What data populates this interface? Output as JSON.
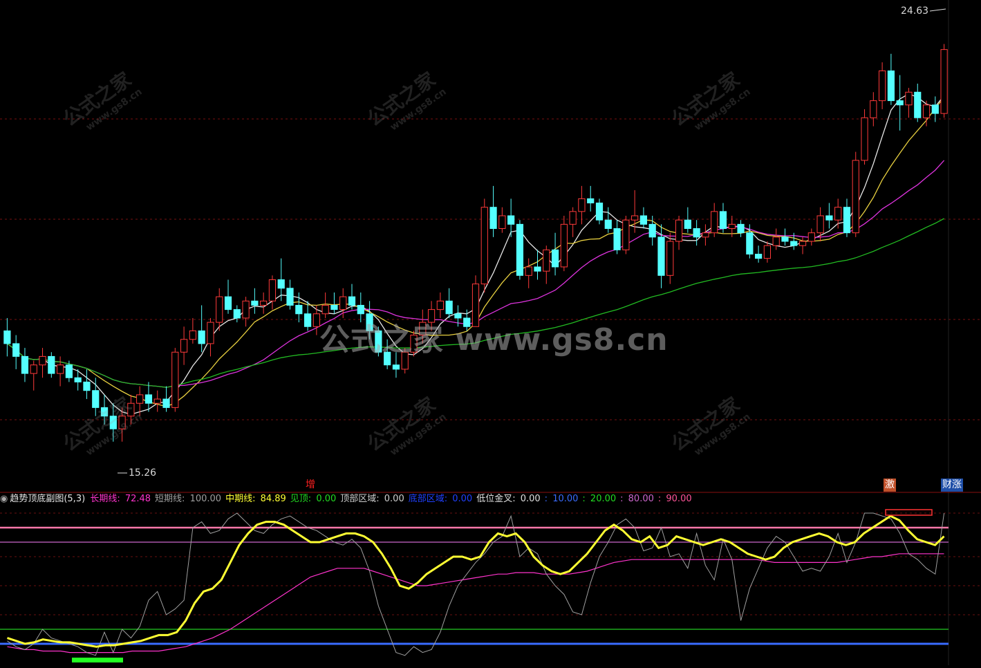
{
  "main_chart": {
    "price_high_label": "24.63",
    "price_low_label": "15.26",
    "watermark_center": "公式之家 www.gs8.cn",
    "watermark_small_cn": "公式之家",
    "watermark_small_url": "www.gs8.cn"
  },
  "signals": [
    {
      "text": "增",
      "color": "#ff2020",
      "bg": "#000"
    },
    {
      "text": "激",
      "color": "#fff",
      "bg": "#c0502a"
    },
    {
      "text": "财涨",
      "color": "#fff",
      "bg": "#1f4fa8"
    }
  ],
  "indicator_legend": {
    "title": "趋势顶底副图(5,3)",
    "items": [
      {
        "label": "长期线: ",
        "value": "72.48",
        "color": "#ff33cc"
      },
      {
        "label": "短期线: ",
        "value": "100.00",
        "color": "#a0a0a0"
      },
      {
        "label": "中期线: ",
        "value": "84.89",
        "color": "#ffff33"
      },
      {
        "label": "见顶: ",
        "value": "0.00",
        "color": "#22dd22"
      },
      {
        "label": "顶部区域: ",
        "value": "0.00",
        "color": "#cfcfcf"
      },
      {
        "label": "底部区域: ",
        "value": "0.00",
        "color": "#2040ff"
      },
      {
        "label": "低位金叉: ",
        "value": "0.00",
        "color": "#e0e0e0"
      },
      {
        "label": ": ",
        "value": "10.00",
        "color": "#3a6cff"
      },
      {
        "label": ": ",
        "value": "20.00",
        "color": "#22dd22"
      },
      {
        "label": ": ",
        "value": "80.00",
        "color": "#cc66cc"
      },
      {
        "label": ": ",
        "value": "90.00",
        "color": "#ff5599"
      }
    ]
  },
  "chart_data": [
    {
      "type": "candlestick",
      "title": "",
      "ylim": [
        14.5,
        25.5
      ],
      "high": 24.63,
      "low": 15.26,
      "candles": [
        [
          17.9,
          18.2,
          17.3,
          17.6
        ],
        [
          17.6,
          17.8,
          17.0,
          17.3
        ],
        [
          17.3,
          17.5,
          16.7,
          16.9
        ],
        [
          16.9,
          17.2,
          16.5,
          17.1
        ],
        [
          17.1,
          17.5,
          16.8,
          17.3
        ],
        [
          17.3,
          17.4,
          16.8,
          16.9
        ],
        [
          16.9,
          17.3,
          16.6,
          17.1
        ],
        [
          17.1,
          17.2,
          16.7,
          16.8
        ],
        [
          16.8,
          17.0,
          16.5,
          16.7
        ],
        [
          16.7,
          17.0,
          16.3,
          16.5
        ],
        [
          16.5,
          16.8,
          15.9,
          16.1
        ],
        [
          16.1,
          16.4,
          15.7,
          15.9
        ],
        [
          15.9,
          16.2,
          15.3,
          15.6
        ],
        [
          15.6,
          16.1,
          15.3,
          15.9
        ],
        [
          15.9,
          16.4,
          15.7,
          16.2
        ],
        [
          16.2,
          16.6,
          15.9,
          16.4
        ],
        [
          16.4,
          16.7,
          16.0,
          16.2
        ],
        [
          16.2,
          16.5,
          16.0,
          16.3
        ],
        [
          16.3,
          16.6,
          16.0,
          16.1
        ],
        [
          16.1,
          17.5,
          16.0,
          17.4
        ],
        [
          17.4,
          18.0,
          17.1,
          17.7
        ],
        [
          17.7,
          18.2,
          17.6,
          17.9
        ],
        [
          17.9,
          18.5,
          17.4,
          17.6
        ],
        [
          17.6,
          18.2,
          17.3,
          18.1
        ],
        [
          18.1,
          18.9,
          17.9,
          18.7
        ],
        [
          18.7,
          19.1,
          18.3,
          18.4
        ],
        [
          18.4,
          18.5,
          18.1,
          18.2
        ],
        [
          18.2,
          18.7,
          18.0,
          18.6
        ],
        [
          18.6,
          18.9,
          18.3,
          18.5
        ],
        [
          18.5,
          18.8,
          18.3,
          18.6
        ],
        [
          18.6,
          19.2,
          18.4,
          19.1
        ],
        [
          19.1,
          19.6,
          18.6,
          18.9
        ],
        [
          18.9,
          19.1,
          18.4,
          18.5
        ],
        [
          18.5,
          18.8,
          18.1,
          18.3
        ],
        [
          18.3,
          18.6,
          17.9,
          18.0
        ],
        [
          18.0,
          18.5,
          17.8,
          18.3
        ],
        [
          18.3,
          18.8,
          18.2,
          18.5
        ],
        [
          18.5,
          18.8,
          18.3,
          18.4
        ],
        [
          18.4,
          18.9,
          18.2,
          18.7
        ],
        [
          18.7,
          19.0,
          18.4,
          18.5
        ],
        [
          18.5,
          18.8,
          18.1,
          18.3
        ],
        [
          18.3,
          18.6,
          17.7,
          17.9
        ],
        [
          17.9,
          18.0,
          17.3,
          17.4
        ],
        [
          17.4,
          17.7,
          17.0,
          17.1
        ],
        [
          17.1,
          17.4,
          16.8,
          17.0
        ],
        [
          17.0,
          17.5,
          16.9,
          17.4
        ],
        [
          17.4,
          17.9,
          17.3,
          17.8
        ],
        [
          17.8,
          18.4,
          17.6,
          18.1
        ],
        [
          18.1,
          18.6,
          17.9,
          18.4
        ],
        [
          18.4,
          18.8,
          18.2,
          18.6
        ],
        [
          18.6,
          18.9,
          18.2,
          18.3
        ],
        [
          18.3,
          18.5,
          18.0,
          18.2
        ],
        [
          18.2,
          18.4,
          17.9,
          18.0
        ],
        [
          18.0,
          19.2,
          18.0,
          19.0
        ],
        [
          19.0,
          21.0,
          18.8,
          20.8
        ],
        [
          20.8,
          21.3,
          20.1,
          20.3
        ],
        [
          20.3,
          20.8,
          20.2,
          20.6
        ],
        [
          20.6,
          21.0,
          20.1,
          20.4
        ],
        [
          20.4,
          20.5,
          19.1,
          19.2
        ],
        [
          19.2,
          19.6,
          18.9,
          19.4
        ],
        [
          19.4,
          19.8,
          19.1,
          19.3
        ],
        [
          19.3,
          19.9,
          19.0,
          19.8
        ],
        [
          19.8,
          20.2,
          19.2,
          19.4
        ],
        [
          19.4,
          20.6,
          19.3,
          20.4
        ],
        [
          20.4,
          20.8,
          20.1,
          20.7
        ],
        [
          20.7,
          21.3,
          20.4,
          21.0
        ],
        [
          21.0,
          21.3,
          20.7,
          20.9
        ],
        [
          20.9,
          21.0,
          20.4,
          20.5
        ],
        [
          20.5,
          20.8,
          20.2,
          20.3
        ],
        [
          20.3,
          20.5,
          19.7,
          19.8
        ],
        [
          19.8,
          20.6,
          19.7,
          20.5
        ],
        [
          20.5,
          21.2,
          20.2,
          20.6
        ],
        [
          20.6,
          20.8,
          20.3,
          20.4
        ],
        [
          20.4,
          20.6,
          19.9,
          20.1
        ],
        [
          20.1,
          20.4,
          18.9,
          19.2
        ],
        [
          19.2,
          20.2,
          19.0,
          20.0
        ],
        [
          20.0,
          20.6,
          19.8,
          20.5
        ],
        [
          20.5,
          20.8,
          20.2,
          20.3
        ],
        [
          20.3,
          20.5,
          19.9,
          20.1
        ],
        [
          20.1,
          20.4,
          19.9,
          20.2
        ],
        [
          20.2,
          20.9,
          20.1,
          20.7
        ],
        [
          20.7,
          20.9,
          20.2,
          20.3
        ],
        [
          20.3,
          20.6,
          20.1,
          20.4
        ],
        [
          20.4,
          20.5,
          20.1,
          20.2
        ],
        [
          20.2,
          20.4,
          19.6,
          19.7
        ],
        [
          19.7,
          19.9,
          19.5,
          19.6
        ],
        [
          19.6,
          20.0,
          19.5,
          19.9
        ],
        [
          19.9,
          20.3,
          19.8,
          20.1
        ],
        [
          20.1,
          20.3,
          19.9,
          20.0
        ],
        [
          20.0,
          20.2,
          19.8,
          19.9
        ],
        [
          19.9,
          20.1,
          19.7,
          20.0
        ],
        [
          20.0,
          20.3,
          19.9,
          20.2
        ],
        [
          20.2,
          20.8,
          20.0,
          20.6
        ],
        [
          20.6,
          20.9,
          20.3,
          20.5
        ],
        [
          20.5,
          21.0,
          20.3,
          20.8
        ],
        [
          20.8,
          21.0,
          20.1,
          20.2
        ],
        [
          20.2,
          22.1,
          20.1,
          21.9
        ],
        [
          21.9,
          23.1,
          21.8,
          22.9
        ],
        [
          22.9,
          23.5,
          22.7,
          23.3
        ],
        [
          23.3,
          24.2,
          23.1,
          24.0
        ],
        [
          24.0,
          24.4,
          23.2,
          23.3
        ],
        [
          23.3,
          23.9,
          22.6,
          23.2
        ],
        [
          23.2,
          23.6,
          22.9,
          23.5
        ],
        [
          23.5,
          23.7,
          22.8,
          22.9
        ],
        [
          22.9,
          23.3,
          22.7,
          23.2
        ],
        [
          23.2,
          23.4,
          22.8,
          23.0
        ],
        [
          23.0,
          24.63,
          22.9,
          24.5
        ]
      ]
    },
    {
      "type": "line",
      "title": "趋势顶底副图(5,3)",
      "ylim": [
        0,
        100
      ],
      "reference_lines": [
        10,
        20,
        80,
        90
      ],
      "series": [
        {
          "name": "长期线",
          "color": "#ff33cc",
          "values": [
            8,
            7,
            6,
            6,
            5,
            5,
            5,
            4,
            4,
            4,
            4,
            4,
            4,
            4,
            5,
            5,
            5,
            5,
            6,
            7,
            8,
            10,
            12,
            14,
            17,
            20,
            24,
            28,
            32,
            36,
            40,
            44,
            48,
            52,
            56,
            58,
            60,
            62,
            62,
            62,
            62,
            60,
            58,
            56,
            54,
            52,
            50,
            50,
            51,
            52,
            53,
            54,
            55,
            56,
            57,
            58,
            58,
            59,
            59,
            59,
            58,
            58,
            58,
            58,
            59,
            60,
            62,
            64,
            66,
            67,
            68,
            68,
            68,
            68,
            68,
            68,
            68,
            68,
            68,
            68,
            68,
            68,
            68,
            68,
            68,
            67,
            66,
            66,
            66,
            66,
            66,
            66,
            66,
            66,
            67,
            68,
            69,
            70,
            70,
            71,
            72,
            72,
            72,
            72,
            72,
            72
          ]
        },
        {
          "name": "短期线",
          "color": "#a0a0a0",
          "values": [
            12,
            8,
            6,
            10,
            20,
            14,
            12,
            10,
            8,
            4,
            2,
            18,
            4,
            20,
            14,
            22,
            40,
            46,
            30,
            34,
            40,
            90,
            94,
            86,
            88,
            96,
            100,
            94,
            88,
            86,
            92,
            96,
            98,
            94,
            90,
            88,
            84,
            80,
            78,
            82,
            76,
            60,
            36,
            20,
            4,
            2,
            8,
            4,
            6,
            18,
            36,
            50,
            58,
            66,
            72,
            80,
            84,
            98,
            70,
            76,
            72,
            58,
            50,
            44,
            32,
            30,
            52,
            70,
            80,
            92,
            96,
            90,
            74,
            76,
            90,
            70,
            72,
            62,
            86,
            64,
            54,
            82,
            68,
            26,
            48,
            62,
            76,
            84,
            80,
            70,
            60,
            62,
            60,
            70,
            86,
            66,
            80,
            100,
            100,
            98,
            96,
            86,
            72,
            68,
            62,
            58,
            100
          ]
        },
        {
          "name": "中期线",
          "color": "#ffff33",
          "values": [
            14,
            12,
            10,
            11,
            13,
            12,
            11,
            11,
            10,
            9,
            8,
            9,
            9,
            10,
            11,
            12,
            14,
            16,
            16,
            18,
            26,
            38,
            46,
            48,
            54,
            66,
            78,
            86,
            92,
            94,
            94,
            92,
            88,
            84,
            80,
            80,
            82,
            84,
            86,
            86,
            84,
            80,
            72,
            62,
            50,
            48,
            52,
            58,
            62,
            66,
            70,
            70,
            68,
            70,
            80,
            86,
            84,
            86,
            80,
            70,
            64,
            60,
            58,
            60,
            66,
            72,
            80,
            88,
            92,
            88,
            82,
            80,
            84,
            76,
            78,
            84,
            82,
            80,
            78,
            80,
            82,
            80,
            76,
            72,
            70,
            68,
            70,
            76,
            80,
            82,
            84,
            86,
            84,
            80,
            78,
            80,
            86,
            90,
            94,
            98,
            95,
            88,
            82,
            80,
            78,
            84
          ]
        }
      ]
    }
  ]
}
